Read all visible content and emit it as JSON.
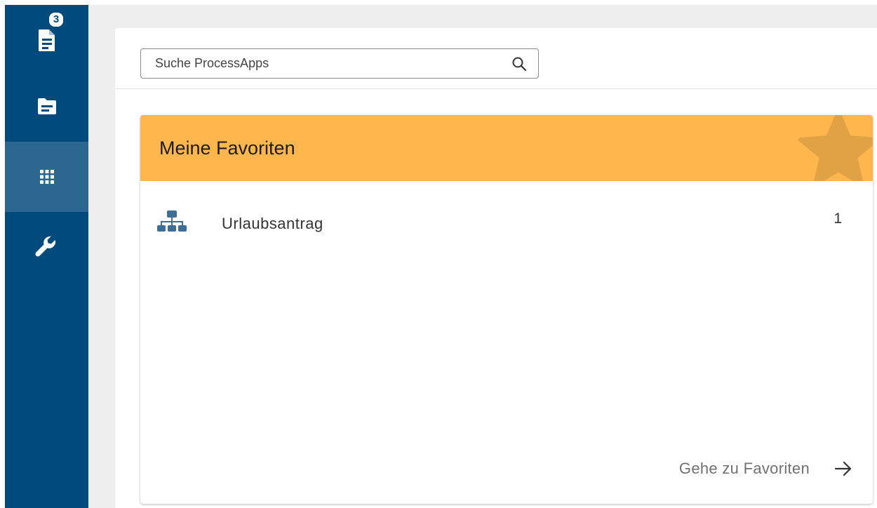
{
  "sidebar": {
    "items": [
      {
        "icon": "task-list-icon",
        "badge": "3",
        "active": false
      },
      {
        "icon": "folder-icon",
        "active": false
      },
      {
        "icon": "apps-grid-icon",
        "active": true
      },
      {
        "icon": "wrench-icon",
        "active": false
      }
    ]
  },
  "search": {
    "placeholder": "Suche ProcessApps",
    "value": "",
    "icon": "search-icon"
  },
  "favorites": {
    "title": "Meine Favoriten",
    "header_color": "#ffb74d",
    "header_icon": "star-icon",
    "items": [
      {
        "icon": "sitemap-icon",
        "label": "Urlaubsantrag",
        "count": "1"
      }
    ],
    "footer_label": "Gehe zu Favoriten",
    "footer_icon": "arrow-right-icon"
  },
  "colors": {
    "sidebar": "#004a7c",
    "sidebar_active": "#2b6791",
    "accent": "#ffb74d",
    "icon_blue": "#3d6f96"
  }
}
